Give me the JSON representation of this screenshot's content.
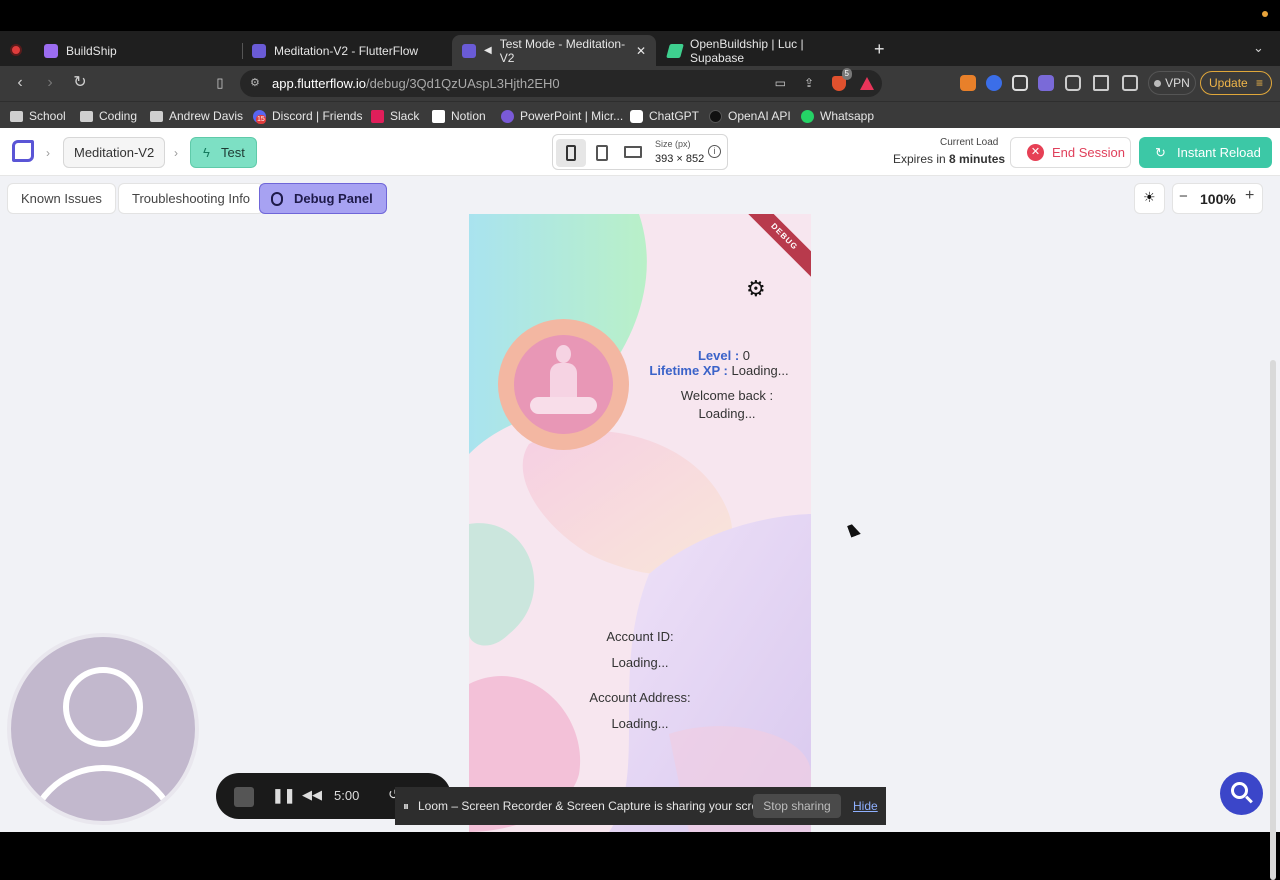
{
  "tabs": [
    {
      "label": "BuildShip",
      "icon": "buildship-icon",
      "color": "#9b6cf0"
    },
    {
      "label": "Meditation-V2 - FlutterFlow",
      "icon": "flutterflow-icon",
      "color": "#6a5bd6"
    },
    {
      "label": "Test Mode - Meditation-V2",
      "icon": "flutterflow-icon",
      "color": "#6a5bd6",
      "active": true
    },
    {
      "label": "OpenBuildship | Luc | Supabase",
      "icon": "supabase-icon",
      "color": "#3ecf8e"
    }
  ],
  "address": {
    "host": "app.flutterflow.io",
    "path": "/debug/3Qd1QzUAspL3Hjth2EH0"
  },
  "browser": {
    "vpn": "VPN",
    "update": "Update",
    "brave_badge": "5"
  },
  "bookmarks": [
    "School",
    "Coding",
    "Andrew Davis",
    "Discord | Friends",
    "Slack",
    "Notion",
    "PowerPoint | Micr...",
    "ChatGPT",
    "OpenAI API",
    "Whatsapp"
  ],
  "discord_badge": "15",
  "flutterflow": {
    "project": "Meditation-V2",
    "mode": "Test",
    "size_label": "Size (px)",
    "size_value": "393 × 852",
    "current_load": "Current Load",
    "expires_prefix": "Expires in",
    "expires_value": "8 minutes",
    "end_session": "End Session",
    "instant_reload": "Instant Reload"
  },
  "toolbar": {
    "known_issues": "Known Issues",
    "troubleshooting": "Troubleshooting Info",
    "debug_panel": "Debug Panel",
    "zoom": "100%"
  },
  "app": {
    "ribbon": "DEBUG",
    "level_label": "Level :",
    "level_value": "0",
    "xp_label": "Lifetime XP :",
    "xp_value": "Loading...",
    "welcome": "Welcome back :",
    "welcome_value": "Loading...",
    "account_id_label": "Account ID:",
    "account_id_value": "Loading...",
    "account_address_label": "Account Address:",
    "account_address_value": "Loading..."
  },
  "loom": {
    "timer": "5:00",
    "share_text": "Loom – Screen Recorder & Screen Capture is sharing your screen.",
    "stop_sharing": "Stop sharing",
    "hide": "Hide"
  },
  "colors": {
    "accent_teal": "#3cc8a6",
    "debug_purple": "#a7a2f2",
    "end_red": "#e64055",
    "level_blue": "#3b63c9"
  }
}
